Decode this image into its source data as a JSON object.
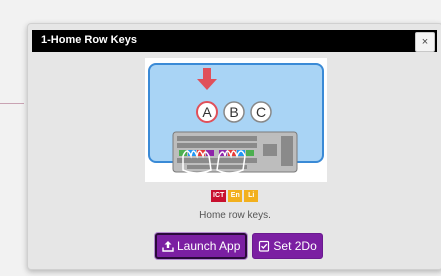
{
  "dialog": {
    "title": "1-Home Row Keys",
    "close_icon": "close-icon",
    "close_label": "×"
  },
  "thumbnail": {
    "letters": [
      "A",
      "B",
      "C"
    ],
    "colors": {
      "panel": "#a9d4f5",
      "panel_border": "#3a8ad6",
      "arrow": "#e0505a",
      "keyboard": "#9a9a9a"
    }
  },
  "badges": [
    {
      "label": "ICT",
      "color": "#c8102e"
    },
    {
      "label": "En",
      "color": "#f2b01e"
    },
    {
      "label": "Li",
      "color": "#f2b01e"
    }
  ],
  "caption": "Home row keys.",
  "buttons": {
    "launch": {
      "label": "Launch App",
      "icon": "upload-icon"
    },
    "set": {
      "label": "Set 2Do",
      "icon": "checklist-icon"
    }
  },
  "colors": {
    "accent": "#7b1fa2",
    "titlebar": "#000000"
  }
}
